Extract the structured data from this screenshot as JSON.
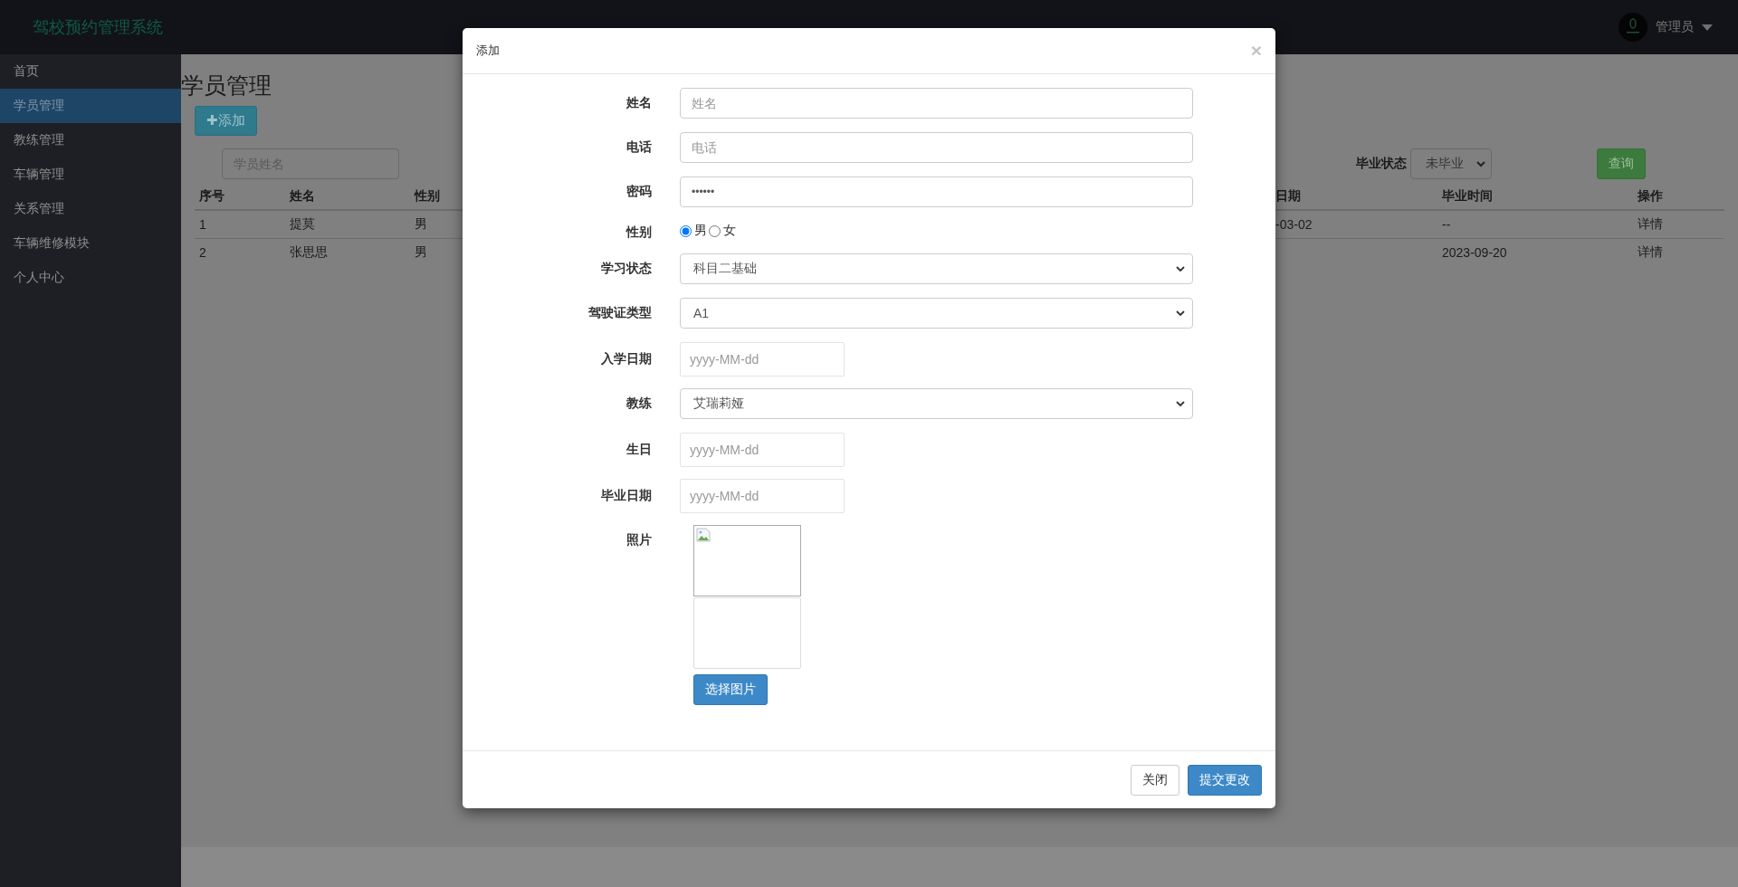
{
  "header": {
    "brand": "驾校预约管理系统",
    "user": {
      "name": "管理员"
    }
  },
  "sidebar": {
    "items": [
      {
        "label": "首页",
        "selected": false
      },
      {
        "label": "学员管理",
        "selected": true
      },
      {
        "label": "教练管理",
        "selected": false
      },
      {
        "label": "车辆管理",
        "selected": false
      },
      {
        "label": "关系管理",
        "selected": false
      },
      {
        "label": "车辆维修模块",
        "selected": false
      },
      {
        "label": "个人中心",
        "selected": false
      }
    ]
  },
  "page": {
    "title": "学员管理",
    "add_button": {
      "icon": "✚",
      "label": "添加"
    },
    "search": {
      "placeholder": "学员姓名"
    },
    "filter": {
      "label": "毕业状态",
      "value": "未毕业"
    },
    "query_button": "查询",
    "table": {
      "columns": [
        "序号",
        "姓名",
        "性别",
        "日期",
        "毕业时间",
        "操作"
      ],
      "rows": [
        {
          "cells": [
            "1",
            "提莫",
            "男",
            "-03-02",
            "--",
            "详情"
          ]
        },
        {
          "cells": [
            "2",
            "张思思",
            "男",
            null,
            "2023-09-20",
            "详情"
          ]
        }
      ]
    }
  },
  "modal": {
    "title": "添加",
    "close": "×",
    "fields": [
      {
        "kind": "text",
        "label": "姓名",
        "placeholder": "姓名"
      },
      {
        "kind": "text",
        "label": "电话",
        "placeholder": "电话"
      },
      {
        "kind": "password",
        "label": "密码",
        "value": "••••••"
      },
      {
        "kind": "radio",
        "label": "性别",
        "options": [
          {
            "label": "男",
            "selected": true
          },
          {
            "label": "女",
            "selected": false
          }
        ]
      },
      {
        "kind": "select",
        "label": "学习状态",
        "value": "科目二基础"
      },
      {
        "kind": "select",
        "label": "驾驶证类型",
        "value": "A1"
      },
      {
        "kind": "date",
        "label": "入学日期",
        "placeholder": "yyyy-MM-dd"
      },
      {
        "kind": "select",
        "label": "教练",
        "value": "艾瑞莉娅"
      },
      {
        "kind": "date",
        "label": "生日",
        "placeholder": "yyyy-MM-dd"
      },
      {
        "kind": "date",
        "label": "毕业日期",
        "placeholder": "yyyy-MM-dd"
      },
      {
        "kind": "photo",
        "label": "照片",
        "button": "选择图片"
      }
    ],
    "buttons": [
      {
        "kind": "default",
        "label": "关闭"
      },
      {
        "kind": "primary",
        "label": "提交更改"
      }
    ]
  }
}
